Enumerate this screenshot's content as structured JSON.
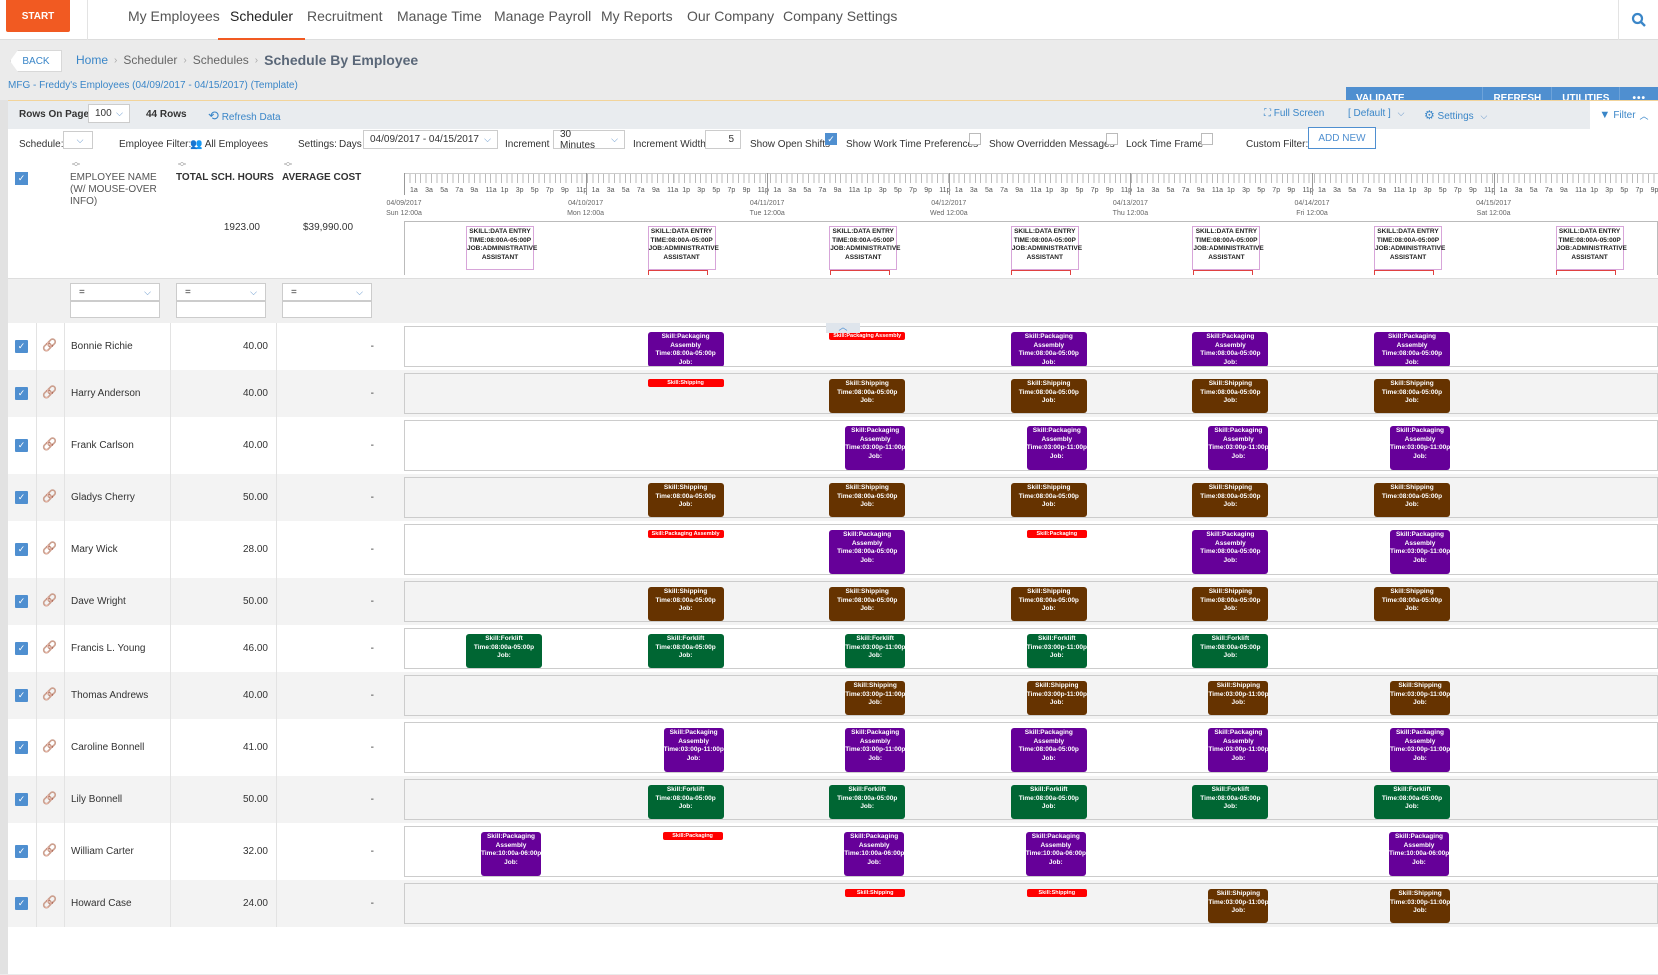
{
  "nav": {
    "start": "START",
    "items": [
      "My Employees",
      "Scheduler",
      "Recruitment",
      "Manage Time",
      "Manage Payroll",
      "My Reports",
      "Our Company",
      "Company Settings"
    ],
    "active": "Scheduler",
    "search_icon": "search-icon"
  },
  "breadcrumb": {
    "back": "BACK",
    "items": [
      "Home",
      "Scheduler",
      "Schedules"
    ],
    "current": "Schedule By Employee",
    "subtitle": "MFG - Freddy's Employees (04/09/2017 - 04/15/2017) (Template)"
  },
  "actions": [
    "VALIDATE CONSTRAINTS",
    "REFRESH",
    "UTILITIES",
    "•••"
  ],
  "toolbar": {
    "rows_on_page_label": "Rows On Page",
    "rows_on_page_value": "100",
    "rows_count": "44 Rows",
    "refresh_data": "Refresh Data",
    "full_screen": "Full Screen",
    "view_default": "[ Default ]",
    "settings": "Settings",
    "filter": "Filter"
  },
  "filters": {
    "schedule_label": "Schedule:",
    "schedule_value": "",
    "employee_filter_label": "Employee Filter:",
    "employee_filter_value": "All Employees",
    "settings_label": "Settings:",
    "days_label": "Days",
    "days_value": "04/09/2017 - 04/15/2017",
    "increment_label": "Increment",
    "increment_value": "30 Minutes",
    "increment_width_label": "Increment Width",
    "increment_width_value": "5",
    "show_open_shifts_label": "Show Open Shifts",
    "show_open_shifts": true,
    "show_work_time_prefs_label": "Show Work Time Preferences",
    "show_work_time_prefs": false,
    "show_overridden_label": "Show Overridden Messages",
    "show_overridden": false,
    "lock_time_frame_label": "Lock Time Frame",
    "lock_time_frame": false,
    "custom_filter_label": "Custom Filter:",
    "add_new": "ADD NEW"
  },
  "columns": {
    "name": "EMPLOYEE NAME (W/ MOUSE-OVER INFO)",
    "name_l1": "EMPLOYEE NAME",
    "name_l2": "(W/ MOUSE-OVER",
    "name_l3": "INFO)",
    "hours": "TOTAL SCH. HOURS",
    "cost": "AVERAGE COST",
    "total_hours": "1923.00",
    "total_cost": "$39,990.00",
    "filter_op": "="
  },
  "timeline": {
    "hour_labels": [
      "1a",
      "3a",
      "5a",
      "7a",
      "9a",
      "11a",
      "1p",
      "3p",
      "5p",
      "7p",
      "9p",
      "11p"
    ],
    "days": [
      {
        "date": "04/09/2017",
        "label": "Sun 12:00a"
      },
      {
        "date": "04/10/2017",
        "label": "Mon 12:00a"
      },
      {
        "date": "04/11/2017",
        "label": "Tue 12:00a"
      },
      {
        "date": "04/12/2017",
        "label": "Wed 12:00a"
      },
      {
        "date": "04/13/2017",
        "label": "Thu 12:00a"
      },
      {
        "date": "04/14/2017",
        "label": "Fri 12:00a"
      },
      {
        "date": "04/15/2017",
        "label": "Sat 12:00a"
      }
    ]
  },
  "template_shift": {
    "line1": "SKILL:DATA ENTRY",
    "line2": "TIME:08:00A-05:00P",
    "line3": "JOB:ADMINISTRATIVE",
    "line4": "ASSISTANT",
    "days": [
      0,
      1,
      2,
      3,
      4,
      5,
      6
    ]
  },
  "employees": [
    {
      "name": "Bonnie Richie",
      "hours": "40.00",
      "cost": "-",
      "shifts": [
        {
          "day": 1,
          "skill": "Packaging Assembly",
          "time": "08:00a-05:00p",
          "type": "pk"
        },
        {
          "day": 2,
          "skill": "Packaging Assembly",
          "open": true
        },
        {
          "day": 3,
          "skill": "Packaging Assembly",
          "time": "08:00a-05:00p",
          "type": "pk"
        },
        {
          "day": 4,
          "skill": "Packaging Assembly",
          "time": "08:00a-05:00p",
          "type": "pk"
        },
        {
          "day": 5,
          "skill": "Packaging Assembly",
          "time": "08:00a-05:00p",
          "type": "pk"
        }
      ]
    },
    {
      "name": "Harry Anderson",
      "hours": "40.00",
      "cost": "-",
      "shifts": [
        {
          "day": 1,
          "skill": "Shipping",
          "open": true
        },
        {
          "day": 2,
          "skill": "Shipping",
          "time": "08:00a-05:00p",
          "type": "sh"
        },
        {
          "day": 3,
          "skill": "Shipping",
          "time": "08:00a-05:00p",
          "type": "sh"
        },
        {
          "day": 4,
          "skill": "Shipping",
          "time": "08:00a-05:00p",
          "type": "sh"
        },
        {
          "day": 5,
          "skill": "Shipping",
          "time": "08:00a-05:00p",
          "type": "sh"
        }
      ]
    },
    {
      "name": "Frank Carlson",
      "hours": "40.00",
      "cost": "-",
      "shifts": [
        {
          "day": 2,
          "skill": "Packaging Assembly",
          "time": "03:00p-11:00p",
          "type": "pk",
          "late": true
        },
        {
          "day": 3,
          "skill": "Packaging Assembly",
          "time": "03:00p-11:00p",
          "type": "pk",
          "late": true
        },
        {
          "day": 4,
          "skill": "Packaging Assembly",
          "time": "03:00p-11:00p",
          "type": "pk",
          "late": true
        },
        {
          "day": 5,
          "skill": "Packaging Assembly",
          "time": "03:00p-11:00p",
          "type": "pk",
          "late": true
        }
      ]
    },
    {
      "name": "Gladys Cherry",
      "hours": "50.00",
      "cost": "-",
      "shifts": [
        {
          "day": 1,
          "skill": "Shipping",
          "time": "08:00a-05:00p",
          "type": "sh"
        },
        {
          "day": 2,
          "skill": "Shipping",
          "time": "08:00a-05:00p",
          "type": "sh"
        },
        {
          "day": 3,
          "skill": "Shipping",
          "time": "08:00a-05:00p",
          "type": "sh"
        },
        {
          "day": 4,
          "skill": "Shipping",
          "time": "08:00a-05:00p",
          "type": "sh"
        },
        {
          "day": 5,
          "skill": "Shipping",
          "time": "08:00a-05:00p",
          "type": "sh"
        }
      ]
    },
    {
      "name": "Mary Wick",
      "hours": "28.00",
      "cost": "-",
      "shifts": [
        {
          "day": 1,
          "skill": "Packaging Assembly",
          "open": true
        },
        {
          "day": 2,
          "skill": "Packaging Assembly",
          "time": "08:00a-05:00p",
          "type": "pk"
        },
        {
          "day": 3,
          "skill": "Packaging",
          "open": true,
          "late": true
        },
        {
          "day": 4,
          "skill": "Packaging Assembly",
          "time": "08:00a-05:00p",
          "type": "pk"
        },
        {
          "day": 5,
          "skill": "Packaging Assembly",
          "time": "03:00p-11:00p",
          "type": "pk",
          "late": true
        }
      ]
    },
    {
      "name": "Dave Wright",
      "hours": "50.00",
      "cost": "-",
      "shifts": [
        {
          "day": 1,
          "skill": "Shipping",
          "time": "08:00a-05:00p",
          "type": "sh"
        },
        {
          "day": 2,
          "skill": "Shipping",
          "time": "08:00a-05:00p",
          "type": "sh"
        },
        {
          "day": 3,
          "skill": "Shipping",
          "time": "08:00a-05:00p",
          "type": "sh"
        },
        {
          "day": 4,
          "skill": "Shipping",
          "time": "08:00a-05:00p",
          "type": "sh"
        },
        {
          "day": 5,
          "skill": "Shipping",
          "time": "08:00a-05:00p",
          "type": "sh"
        }
      ]
    },
    {
      "name": "Francis L. Young",
      "hours": "46.00",
      "cost": "-",
      "shifts": [
        {
          "day": 0,
          "skill": "Forklift",
          "time": "08:00a-05:00p",
          "type": "fl"
        },
        {
          "day": 1,
          "skill": "Forklift",
          "time": "08:00a-05:00p",
          "type": "fl"
        },
        {
          "day": 2,
          "skill": "Forklift",
          "time": "03:00p-11:00p",
          "type": "fl",
          "late": true
        },
        {
          "day": 3,
          "skill": "Forklift",
          "time": "03:00p-11:00p",
          "type": "fl",
          "late": true
        },
        {
          "day": 4,
          "skill": "Forklift",
          "time": "08:00a-05:00p",
          "type": "fl"
        }
      ]
    },
    {
      "name": "Thomas Andrews",
      "hours": "40.00",
      "cost": "-",
      "shifts": [
        {
          "day": 2,
          "skill": "Shipping",
          "time": "03:00p-11:00p",
          "type": "sh",
          "late": true
        },
        {
          "day": 3,
          "skill": "Shipping",
          "time": "03:00p-11:00p",
          "type": "sh",
          "late": true
        },
        {
          "day": 4,
          "skill": "Shipping",
          "time": "03:00p-11:00p",
          "type": "sh",
          "late": true
        },
        {
          "day": 5,
          "skill": "Shipping",
          "time": "03:00p-11:00p",
          "type": "sh",
          "late": true
        }
      ]
    },
    {
      "name": "Caroline Bonnell",
      "hours": "41.00",
      "cost": "-",
      "shifts": [
        {
          "day": 1,
          "skill": "Packaging Assembly",
          "time": "03:00p-11:00p",
          "type": "pk",
          "late": true
        },
        {
          "day": 2,
          "skill": "Packaging Assembly",
          "time": "03:00p-11:00p",
          "type": "pk",
          "late": true
        },
        {
          "day": 3,
          "skill": "Packaging Assembly",
          "time": "08:00a-05:00p",
          "type": "pk"
        },
        {
          "day": 4,
          "skill": "Packaging Assembly",
          "time": "03:00p-11:00p",
          "type": "pk",
          "late": true
        },
        {
          "day": 5,
          "skill": "Packaging Assembly",
          "time": "03:00p-11:00p",
          "type": "pk",
          "late": true
        }
      ]
    },
    {
      "name": "Lily Bonnell",
      "hours": "50.00",
      "cost": "-",
      "shifts": [
        {
          "day": 1,
          "skill": "Forklift",
          "time": "08:00a-05:00p",
          "type": "fl"
        },
        {
          "day": 2,
          "skill": "Forklift",
          "time": "08:00a-05:00p",
          "type": "fl"
        },
        {
          "day": 3,
          "skill": "Forklift",
          "time": "08:00a-05:00p",
          "type": "fl"
        },
        {
          "day": 4,
          "skill": "Forklift",
          "time": "08:00a-05:00p",
          "type": "fl"
        },
        {
          "day": 5,
          "skill": "Forklift",
          "time": "08:00a-05:00p",
          "type": "fl"
        }
      ]
    },
    {
      "name": "William Carter",
      "hours": "32.00",
      "cost": "-",
      "shifts": [
        {
          "day": 0,
          "skill": "Packaging Assembly",
          "time": "10:00a-06:00p",
          "type": "pk",
          "mid": true
        },
        {
          "day": 1,
          "skill": "Packaging",
          "open": true,
          "mid": true
        },
        {
          "day": 2,
          "skill": "Packaging Assembly",
          "time": "10:00a-06:00p",
          "type": "pk",
          "mid": true
        },
        {
          "day": 3,
          "skill": "Packaging Assembly",
          "time": "10:00a-06:00p",
          "type": "pk",
          "mid": true
        },
        {
          "day": 5,
          "skill": "Packaging Assembly",
          "time": "10:00a-06:00p",
          "type": "pk",
          "mid": true
        }
      ]
    },
    {
      "name": "Howard Case",
      "hours": "24.00",
      "cost": "-",
      "shifts": [
        {
          "day": 2,
          "skill": "Shipping",
          "open": true,
          "late": true
        },
        {
          "day": 3,
          "skill": "Shipping",
          "open": true,
          "late": true
        },
        {
          "day": 4,
          "skill": "Shipping",
          "time": "03:00p-11:00p",
          "type": "sh",
          "late": true
        },
        {
          "day": 5,
          "skill": "Shipping",
          "time": "03:00p-11:00p",
          "type": "sh",
          "late": true
        }
      ]
    }
  ],
  "colors": {
    "accent": "#f15a22",
    "primary": "#4f8fd0",
    "packaging": "#660099",
    "shipping": "#663300",
    "forklift": "#006633",
    "open_shift": "#ff0000"
  }
}
